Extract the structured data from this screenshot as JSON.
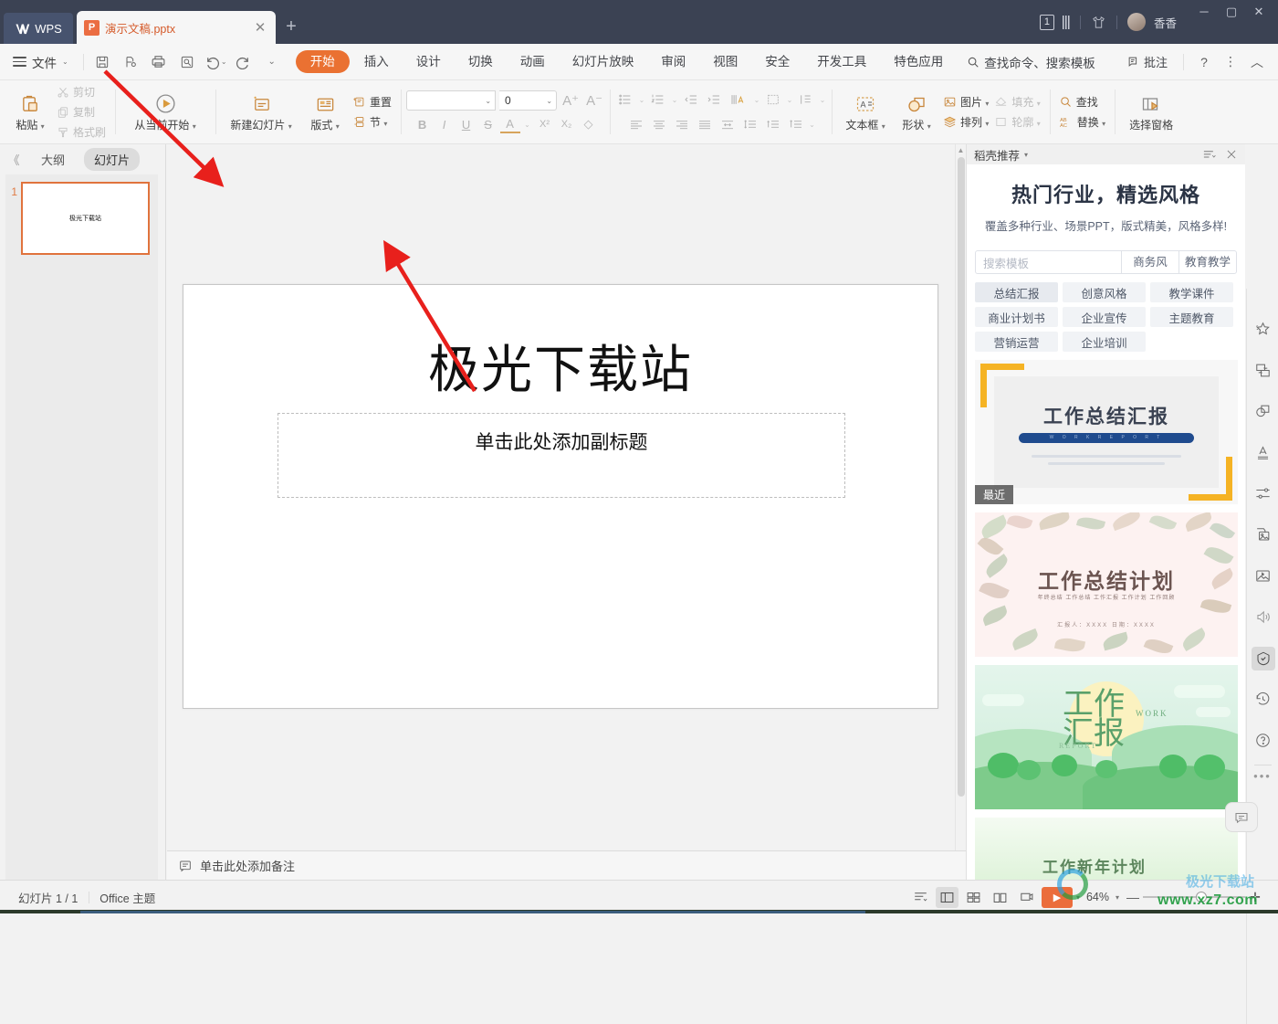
{
  "titlebar": {
    "wps_label": "WPS",
    "doc_tab": {
      "name": "演示文稿.pptx",
      "icon": "P",
      "close": "✕"
    },
    "new_tab": "+",
    "count_badge": "1",
    "user_name": "香香",
    "window_buttons": {
      "minimize": "─",
      "maximize": "▢",
      "close": "✕"
    }
  },
  "menubar": {
    "file_label": "文件",
    "quick_access": [
      "save-icon",
      "save-as-icon",
      "print-icon",
      "print-preview-icon",
      "undo-icon",
      "redo-icon",
      "customize-icon"
    ],
    "tabs": [
      {
        "label": "开始",
        "active": true
      },
      {
        "label": "插入",
        "active": false
      },
      {
        "label": "设计",
        "active": false
      },
      {
        "label": "切换",
        "active": false
      },
      {
        "label": "动画",
        "active": false
      },
      {
        "label": "幻灯片放映",
        "active": false
      },
      {
        "label": "审阅",
        "active": false
      },
      {
        "label": "视图",
        "active": false
      },
      {
        "label": "安全",
        "active": false
      },
      {
        "label": "开发工具",
        "active": false
      },
      {
        "label": "特色应用",
        "active": false
      }
    ],
    "search_label": "查找命令、搜索模板",
    "comment_label": "批注",
    "help_label": "?",
    "more_label": "⋮",
    "collapse_label": "︿"
  },
  "ribbon": {
    "paste": {
      "label": "粘贴",
      "caret": "▾"
    },
    "cut": {
      "label": "剪切",
      "disabled": true
    },
    "copy": {
      "label": "复制",
      "disabled": true
    },
    "format_painter": {
      "label": "格式刷",
      "disabled": true
    },
    "start_from_current": {
      "label": "从当前开始",
      "caret": "▾"
    },
    "new_slide": {
      "label": "新建幻灯片",
      "caret": "▾"
    },
    "layout": {
      "label": "版式",
      "caret": "▾"
    },
    "reset": {
      "label": "重置"
    },
    "section": {
      "label": "节",
      "caret": "▾"
    },
    "font_name": "",
    "font_size": "0",
    "grow_font": "A⁺",
    "shrink_font": "A⁻",
    "bold": "B",
    "italic": "I",
    "underline": "U",
    "strikethrough": "S",
    "font_color": "A",
    "superscript": "X²",
    "subscript": "X₂",
    "clear_format": "◇",
    "text_box": {
      "label": "文本框",
      "caret": "▾"
    },
    "shape": {
      "label": "形状",
      "caret": "▾"
    },
    "picture": {
      "label": "图片",
      "caret": "▾"
    },
    "arrange": {
      "label": "排列",
      "caret": "▾"
    },
    "fill": {
      "label": "填充",
      "caret": "▾",
      "disabled": true
    },
    "outline": {
      "label": "轮廓",
      "caret": "▾",
      "disabled": true
    },
    "find": {
      "label": "查找"
    },
    "replace": {
      "label": "替换",
      "caret": "▾"
    },
    "selection_pane": {
      "label": "选择窗格"
    }
  },
  "thumbnail_panel": {
    "collapse": "《",
    "tab_outline": "大纲",
    "tab_slides": "幻灯片",
    "slides": [
      {
        "number": "1",
        "title": "极光下载站"
      }
    ]
  },
  "slide": {
    "title": "极光下载站",
    "subtitle_placeholder": "单击此处添加副标题"
  },
  "notes": {
    "placeholder": "单击此处添加备注"
  },
  "right_panel": {
    "header_title": "稻壳推荐",
    "header_caret": "▾",
    "hero_title": "热门行业，精选风格",
    "hero_subtitle": "覆盖多种行业、场景PPT，版式精美，风格多样!",
    "search_placeholder": "搜索模板",
    "search_chips": [
      "商务风",
      "教育教学"
    ],
    "tags": [
      {
        "label": "总结汇报",
        "selected": true
      },
      {
        "label": "创意风格",
        "selected": false
      },
      {
        "label": "教学课件",
        "selected": false
      },
      {
        "label": "商业计划书",
        "selected": false
      },
      {
        "label": "企业宣传",
        "selected": false
      },
      {
        "label": "主题教育",
        "selected": false
      },
      {
        "label": "营销运营",
        "selected": false
      },
      {
        "label": "企业培训",
        "selected": false
      }
    ],
    "cards": [
      {
        "title": "工作总结汇报",
        "subtitle": "W O R K   R E P O R T",
        "badge": "最近"
      },
      {
        "title": "工作总结计划",
        "subtitle": "年终总结 工作总结 工作汇报 工作计划 工作回顾",
        "footer": "汇报人：XXXX          日期：XXXX"
      },
      {
        "title": "工作汇报",
        "word_en": "WORK",
        "report_en": "REPORT"
      },
      {
        "title": "工作新年计划"
      }
    ]
  },
  "vertical_toolbar": {
    "items": [
      {
        "icon": "magic-star-icon",
        "selected": false
      },
      {
        "icon": "transfer-icon",
        "selected": false
      },
      {
        "icon": "shapes-icon",
        "selected": false
      },
      {
        "icon": "text-art-icon",
        "selected": false
      },
      {
        "icon": "adjust-sliders-icon",
        "selected": false
      },
      {
        "icon": "gallery-icon",
        "selected": false
      },
      {
        "icon": "image-icon",
        "selected": false
      },
      {
        "icon": "sound-icon",
        "selected": false
      },
      {
        "icon": "shield-check-icon",
        "selected": true
      },
      {
        "icon": "history-icon",
        "selected": false
      },
      {
        "icon": "help-circle-icon",
        "selected": false
      }
    ],
    "more": "•••"
  },
  "statusbar": {
    "slide_count": "幻灯片 1 / 1",
    "theme": "Office 主题",
    "view_buttons": [
      "outline-view-icon",
      "normal-view-icon",
      "slide-sorter-icon",
      "reading-view-icon",
      "presenter-view-icon"
    ],
    "play_label": "▶",
    "play_caret": "▾",
    "zoom_level": "64%",
    "zoom_caret": "▾",
    "zoom_minus": "—",
    "zoom_plus": "✛"
  },
  "watermark": {
    "site": "www.xz7.com",
    "cn": "极光下载站"
  },
  "colors": {
    "titlebar_bg": "#3b4253",
    "accent_orange": "#ea7132",
    "tab_active_bg": "#ea7132",
    "panel_bg": "#f2f2f2",
    "slide_border": "#e0733d",
    "arrow_red": "#e8201c"
  }
}
